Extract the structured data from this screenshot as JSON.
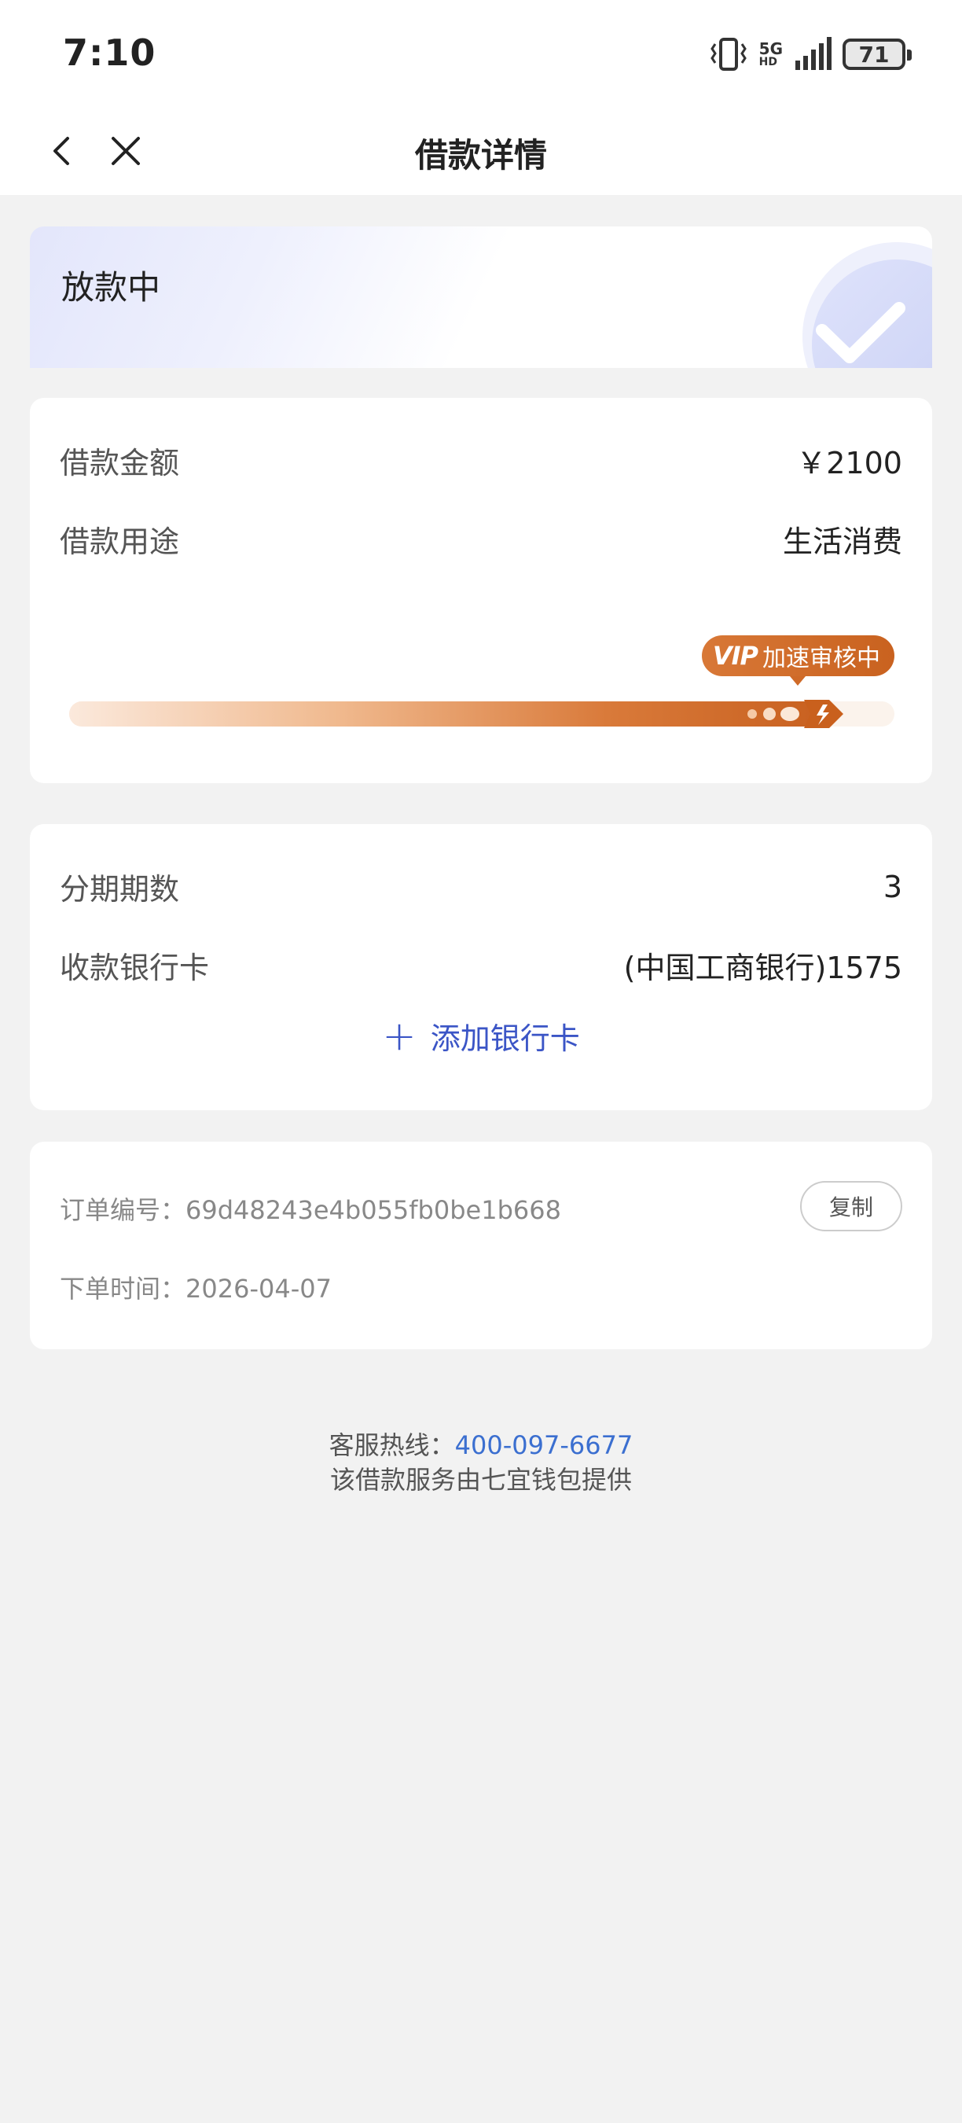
{
  "status_bar": {
    "time": "7:10",
    "network_top": "5G",
    "network_bottom": "HD",
    "battery": "71"
  },
  "header": {
    "title": "借款详情"
  },
  "status_card": {
    "status": "放款中"
  },
  "amount_card": {
    "amount_label": "借款金额",
    "amount_value": "￥2100",
    "purpose_label": "借款用途",
    "purpose_value": "生活消费",
    "vip_logo": "VIP",
    "vip_text": "加速审核中",
    "progress": 0.93,
    "colors": {
      "accent": "#d0692a",
      "track": "#fbf3ec"
    }
  },
  "bank_card": {
    "installments_label": "分期期数",
    "installments_value": "3",
    "bank_label": "收款银行卡",
    "bank_value": "(中国工商银行)1575",
    "add_card_label": "添加银行卡"
  },
  "order_card": {
    "order_no_label": "订单编号：",
    "order_no_value": "69d48243e4b055fb0be1b668",
    "copy_label": "复制",
    "order_time_label": "下单时间：",
    "order_time_value": "2026-04-07"
  },
  "footer": {
    "hotline_label": "客服热线：",
    "hotline_number": "400-097-6677",
    "provider_text": "该借款服务由七宜钱包提供"
  },
  "colors": {
    "link_blue": "#3b55c6",
    "hotline_blue": "#3b6fd0",
    "background": "#f2f2f2"
  }
}
